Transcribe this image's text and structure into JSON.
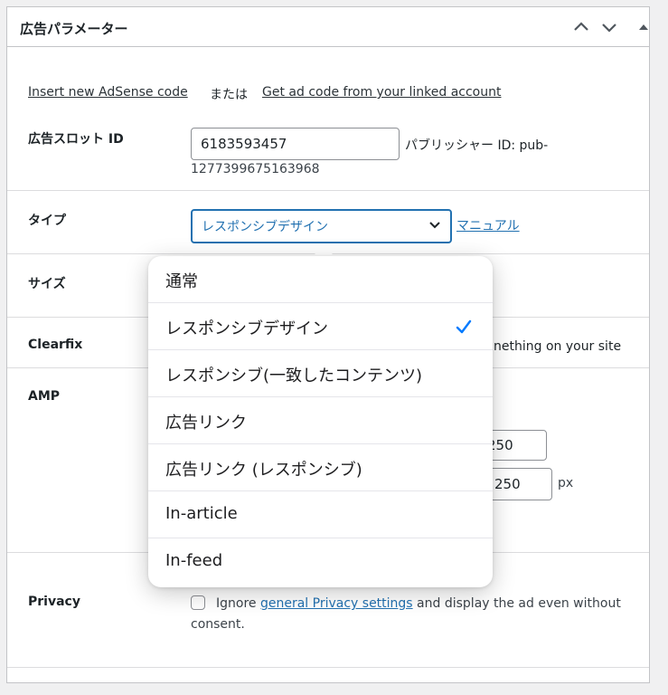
{
  "panel": {
    "title": "広告パラメーター"
  },
  "top_links": {
    "insert_adsense": "Insert new AdSense code",
    "or": "または",
    "get_ad_code": "Get ad code from your linked account"
  },
  "ad_slot": {
    "label": "広告スロット ID",
    "value": "6183593457",
    "publisher_label": "パブリッシャー ID: pub-",
    "publisher_id": "1277399675163968"
  },
  "type": {
    "label": "タイプ",
    "selected": "レスポンシブデザイン",
    "manual_link": "マニュアル"
  },
  "size": {
    "label": "サイズ"
  },
  "clearfix": {
    "label": "Clearfix",
    "partial_text": "nething on your site"
  },
  "amp": {
    "label": "AMP",
    "width_value": "250",
    "height_value": "250",
    "unit": "px"
  },
  "privacy": {
    "label": "Privacy",
    "text_before": "Ignore ",
    "link": "general Privacy settings",
    "text_after": " and display the ad even without",
    "text_line2": "consent."
  },
  "dropdown": {
    "options": [
      "通常",
      "レスポンシブデザイン",
      "レスポンシブ(一致したコンテンツ)",
      "広告リンク",
      "広告リンク (レスポンシブ)",
      "In-article",
      "In-feed"
    ],
    "selected_index": 1
  },
  "colors": {
    "accent": "#2271b1",
    "check": "#007aff"
  }
}
